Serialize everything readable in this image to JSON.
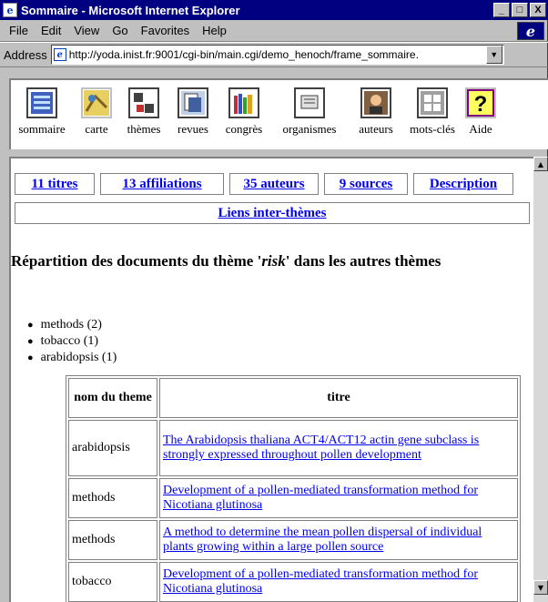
{
  "window": {
    "title": "Sommaire - Microsoft Internet Explorer",
    "buttons": [
      "_",
      "□",
      "X"
    ]
  },
  "menu": {
    "items": [
      "File",
      "Edit",
      "View",
      "Go",
      "Favorites",
      "Help"
    ]
  },
  "address": {
    "label": "Address",
    "url": "http://yoda.inist.fr:9001/cgi-bin/main.cgi/demo_henoch/frame_sommaire.",
    "dropdown": "▼"
  },
  "nav": {
    "items": [
      {
        "label": "sommaire",
        "icon": "list-icon"
      },
      {
        "label": "carte",
        "icon": "map-icon"
      },
      {
        "label": "thèmes",
        "icon": "themes-icon"
      },
      {
        "label": "revues",
        "icon": "journals-icon"
      },
      {
        "label": "congrès",
        "icon": "books-icon"
      },
      {
        "label": "organismes",
        "icon": "organization-icon"
      },
      {
        "label": "auteurs",
        "icon": "author-icon"
      },
      {
        "label": "mots-clés",
        "icon": "keywords-icon"
      },
      {
        "label": "Aide",
        "icon": "help-icon"
      }
    ]
  },
  "tabs": {
    "titres": "11 titres",
    "affiliations": "13 affiliations",
    "auteurs": "35 auteurs",
    "sources": "9 sources",
    "description": "Description",
    "liens": "Liens inter-thèmes"
  },
  "heading": {
    "before": "Répartition des documents du thème '",
    "theme": "risk",
    "after": "' dans les autres thèmes"
  },
  "themes_list": [
    "methods (2)",
    "tobacco (1)",
    "arabidopsis (1)"
  ],
  "table": {
    "headers": [
      "nom du theme",
      "titre"
    ],
    "rows": [
      {
        "theme": "arabidopsis",
        "title": "The Arabidopsis thaliana ACT4/ACT12 actin gene subclass is strongly expressed throughout pollen development"
      },
      {
        "theme": "methods",
        "title": "Development of a pollen-mediated transformation method for Nicotiana glutinosa"
      },
      {
        "theme": "methods",
        "title": "A method to determine the mean pollen dispersal of individual plants growing within a large pollen source"
      },
      {
        "theme": "tobacco",
        "title": "Development of a pollen-mediated transformation method for Nicotiana glutinosa"
      }
    ]
  }
}
